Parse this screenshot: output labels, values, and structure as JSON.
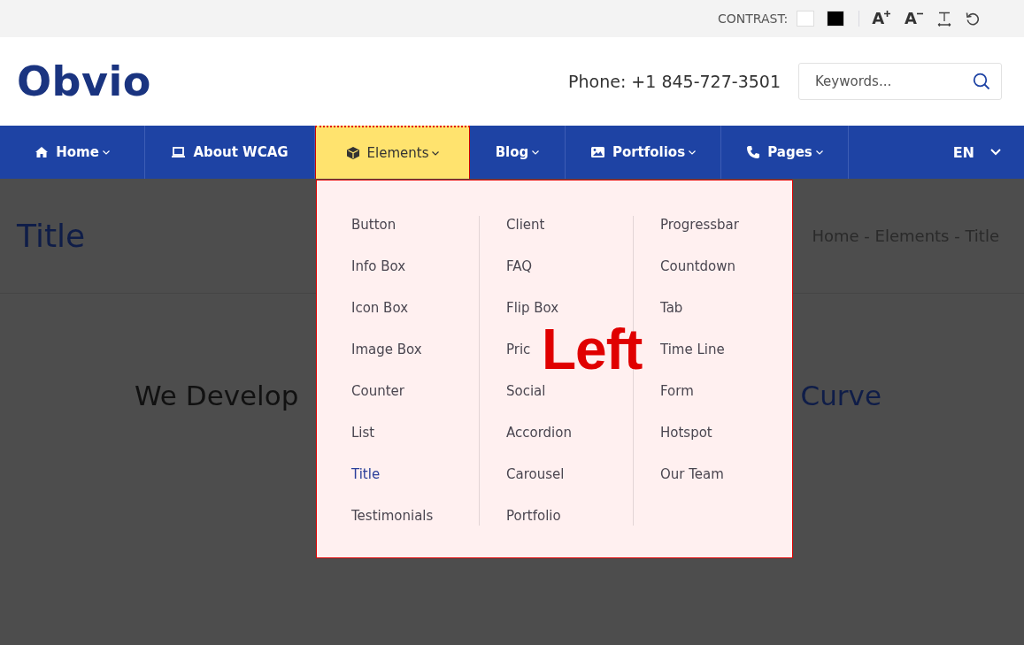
{
  "top_bar": {
    "contrast_label": "CONTRAST:",
    "swatches": [
      {
        "color": "#ffffff"
      },
      {
        "color": "#000000"
      }
    ],
    "font_buttons": [
      {
        "kind": "increase",
        "label": "A"
      },
      {
        "kind": "decrease",
        "label": "A"
      },
      {
        "kind": "line_height"
      },
      {
        "kind": "reset"
      }
    ]
  },
  "header": {
    "logo": "Obvio",
    "phone": "Phone: +1 845-727-3501",
    "search": {
      "placeholder": "Keywords..."
    }
  },
  "nav": {
    "items": [
      {
        "label": "Home",
        "has_menu": true,
        "selected": false
      },
      {
        "label": "About WCAG",
        "has_menu": false,
        "selected": false
      },
      {
        "label": "Elements",
        "has_menu": true,
        "selected": true
      },
      {
        "label": "Blog",
        "has_menu": true,
        "selected": false
      },
      {
        "label": "Portfolios",
        "has_menu": true,
        "selected": false
      },
      {
        "label": "Pages",
        "has_menu": true,
        "selected": false
      }
    ],
    "language": "EN"
  },
  "page": {
    "title": "Title",
    "breadcrumb": "Home - Elements - Title",
    "heading_parts": [
      "We Develop",
      "Curve"
    ]
  },
  "dropdown": {
    "annotation": "Left",
    "columns": [
      [
        {
          "label": "Button",
          "selected": false
        },
        {
          "label": "Info Box",
          "selected": false
        },
        {
          "label": "Icon Box",
          "selected": false
        },
        {
          "label": "Image Box",
          "selected": false
        },
        {
          "label": "Counter",
          "selected": false
        },
        {
          "label": "List",
          "selected": false
        },
        {
          "label": "Title",
          "selected": true
        },
        {
          "label": "Testimonials",
          "selected": false
        }
      ],
      [
        {
          "label": "Client",
          "selected": false
        },
        {
          "label": "FAQ",
          "selected": false
        },
        {
          "label": "Flip Box",
          "selected": false
        },
        {
          "label": "Pric",
          "selected": false
        },
        {
          "label": "Social",
          "selected": false
        },
        {
          "label": "Accordion",
          "selected": false
        },
        {
          "label": "Carousel",
          "selected": false
        },
        {
          "label": "Portfolio",
          "selected": false
        }
      ],
      [
        {
          "label": "Progressbar",
          "selected": false
        },
        {
          "label": "Countdown",
          "selected": false
        },
        {
          "label": "Tab",
          "selected": false
        },
        {
          "label": "Time Line",
          "selected": false
        },
        {
          "label": "Form",
          "selected": false
        },
        {
          "label": "Hotspot",
          "selected": false
        },
        {
          "label": "Our Team",
          "selected": false
        }
      ]
    ]
  }
}
